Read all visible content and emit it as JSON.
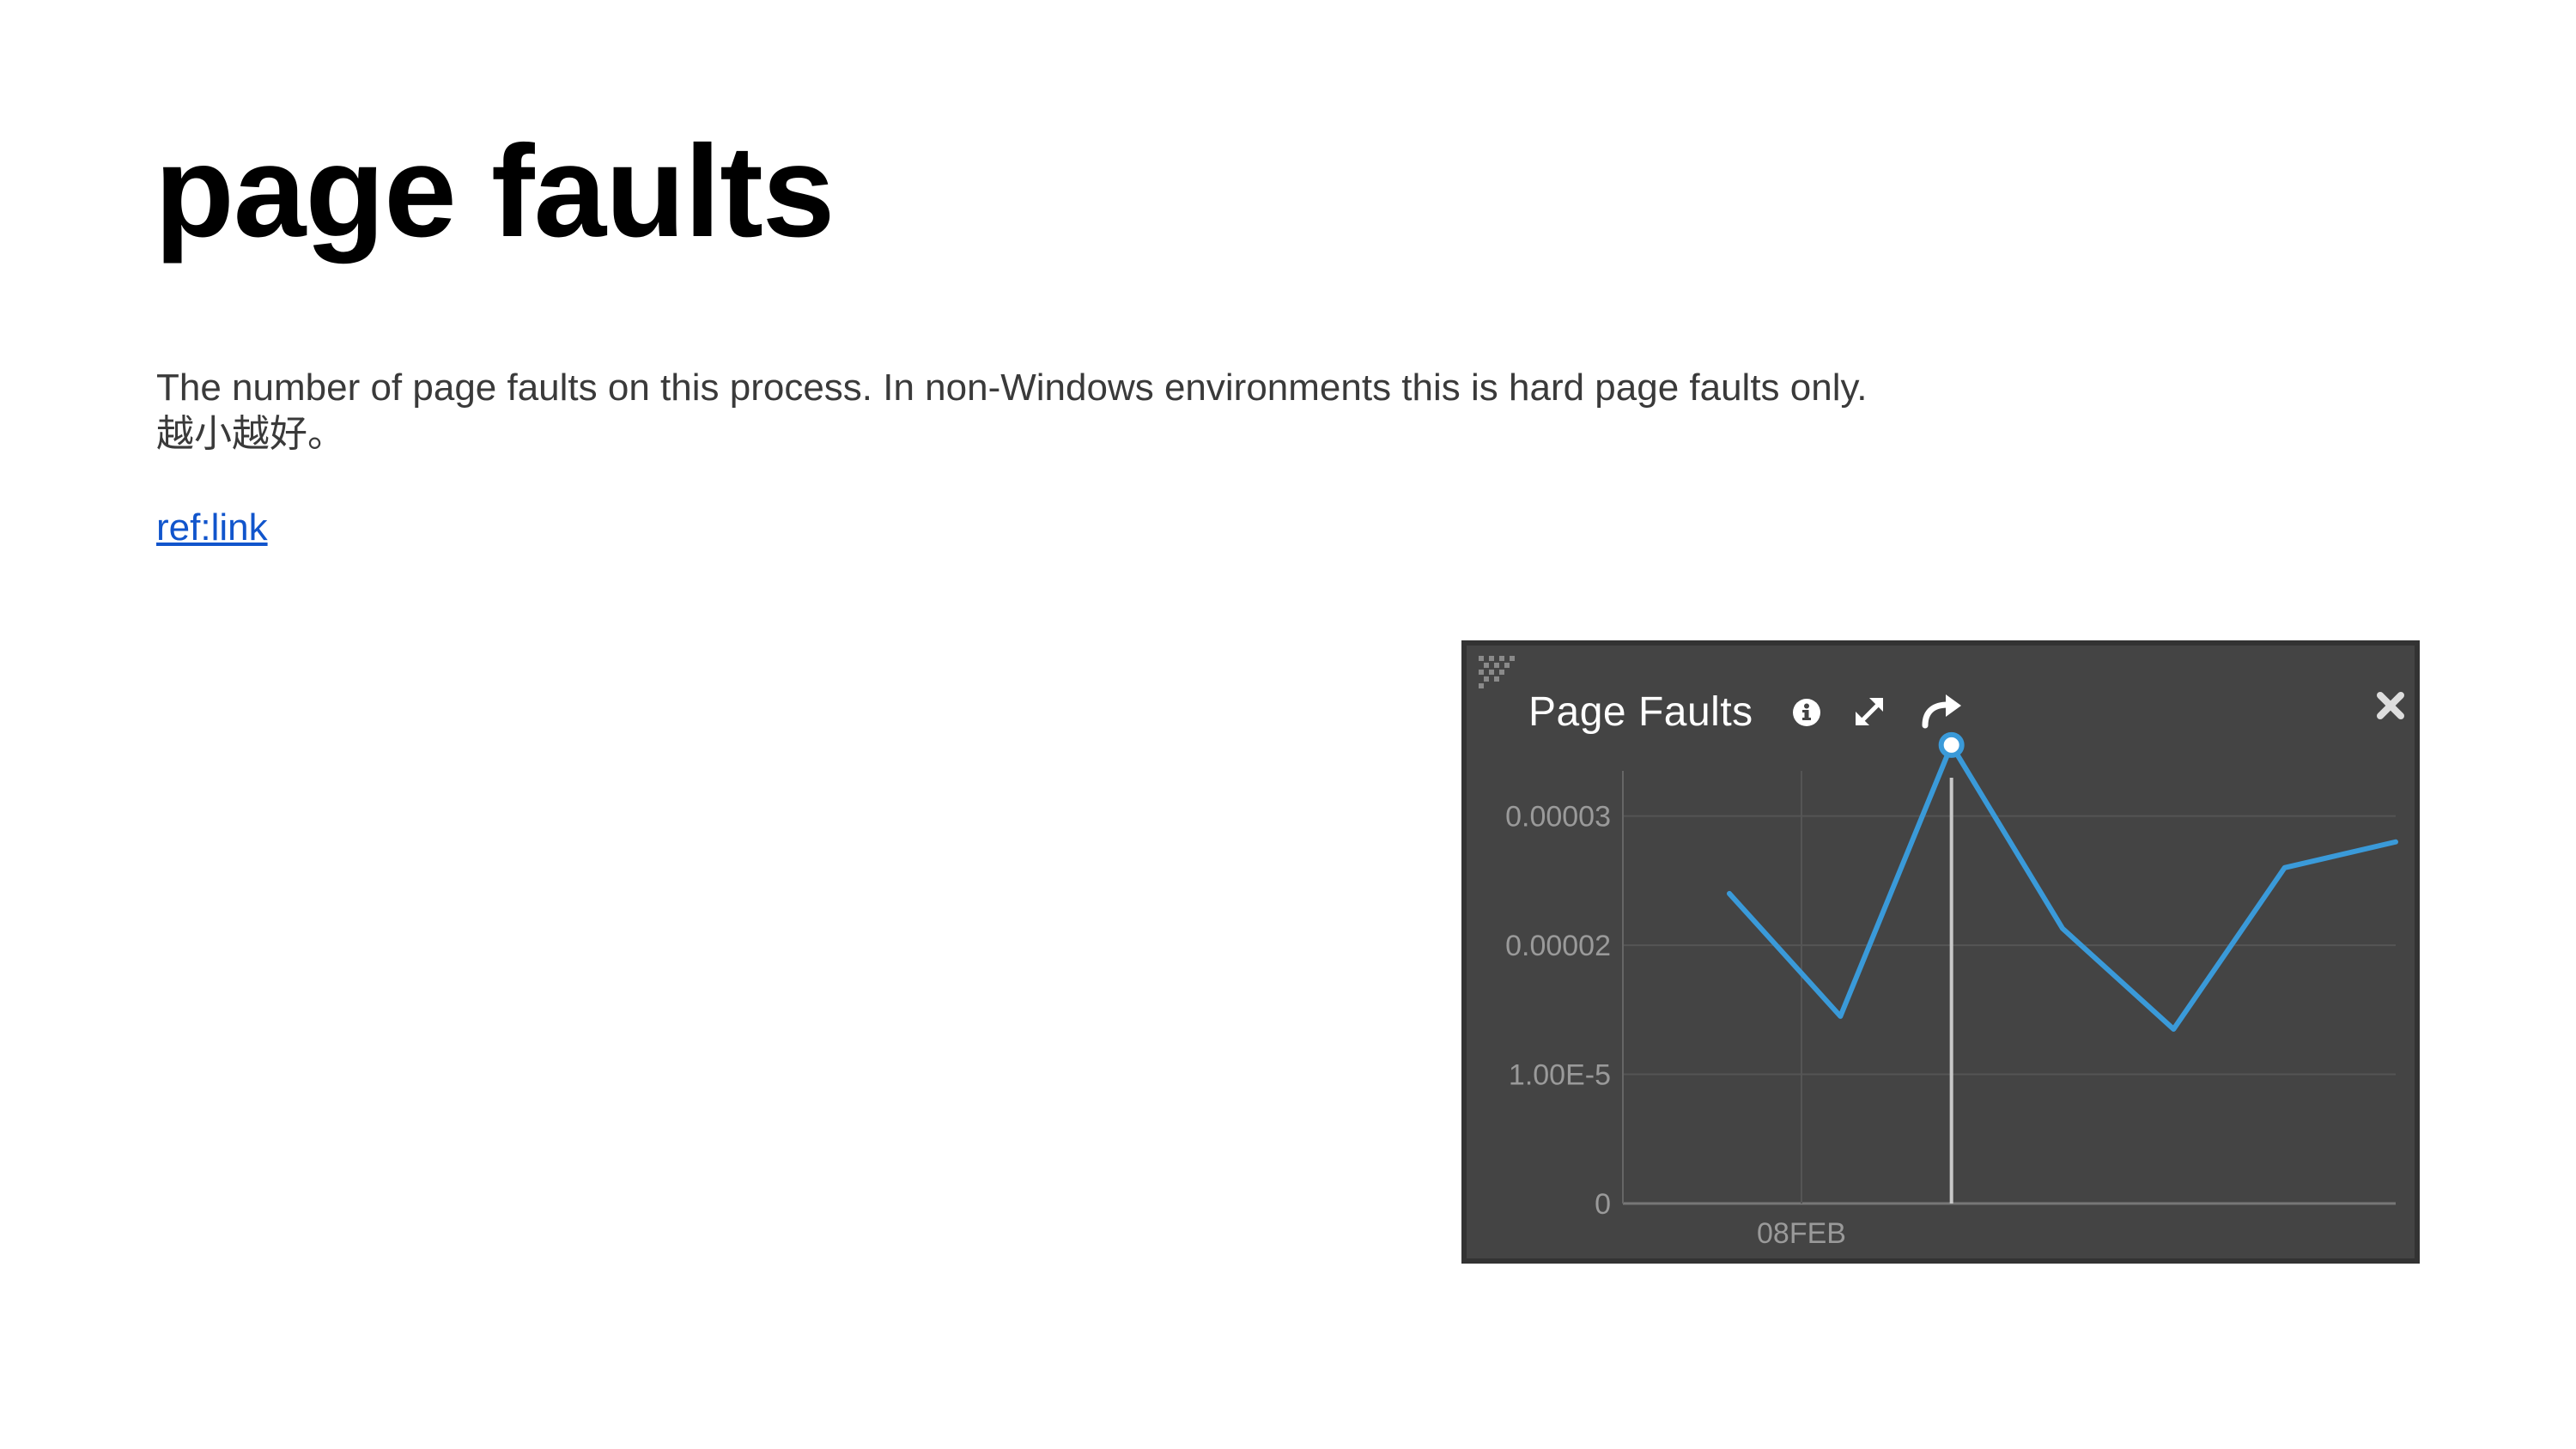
{
  "page": {
    "title": "page faults",
    "description": [
      "The number of page faults on this process. In non-Windows environments this is hard page faults only.",
      "越小越好。"
    ],
    "link": "ref:link"
  },
  "widget": {
    "title": "Page Faults",
    "icons": [
      "grip-icon",
      "info-icon",
      "expand-icon",
      "share-icon",
      "close-icon"
    ]
  },
  "chart_data": {
    "type": "line",
    "y_ticks": [
      "0.00003",
      "0.00002",
      "1.00E-5",
      "0"
    ],
    "y_tick_values": [
      3e-05,
      2e-05,
      1e-05,
      0
    ],
    "x_tick_labels": [
      "08FEB"
    ],
    "ylim": [
      0,
      3.35e-05
    ],
    "series": [
      {
        "values": [
          2.4e-05,
          1.45e-05,
          3.55e-05,
          2.13e-05,
          1.35e-05,
          2.6e-05,
          2.8e-05
        ]
      }
    ],
    "hover_point_index": 2,
    "grid": true,
    "colors": {
      "line": "#3a9ad9",
      "background": "#444444",
      "grid": "#555555",
      "tick_label": "#9a9a9a"
    }
  }
}
